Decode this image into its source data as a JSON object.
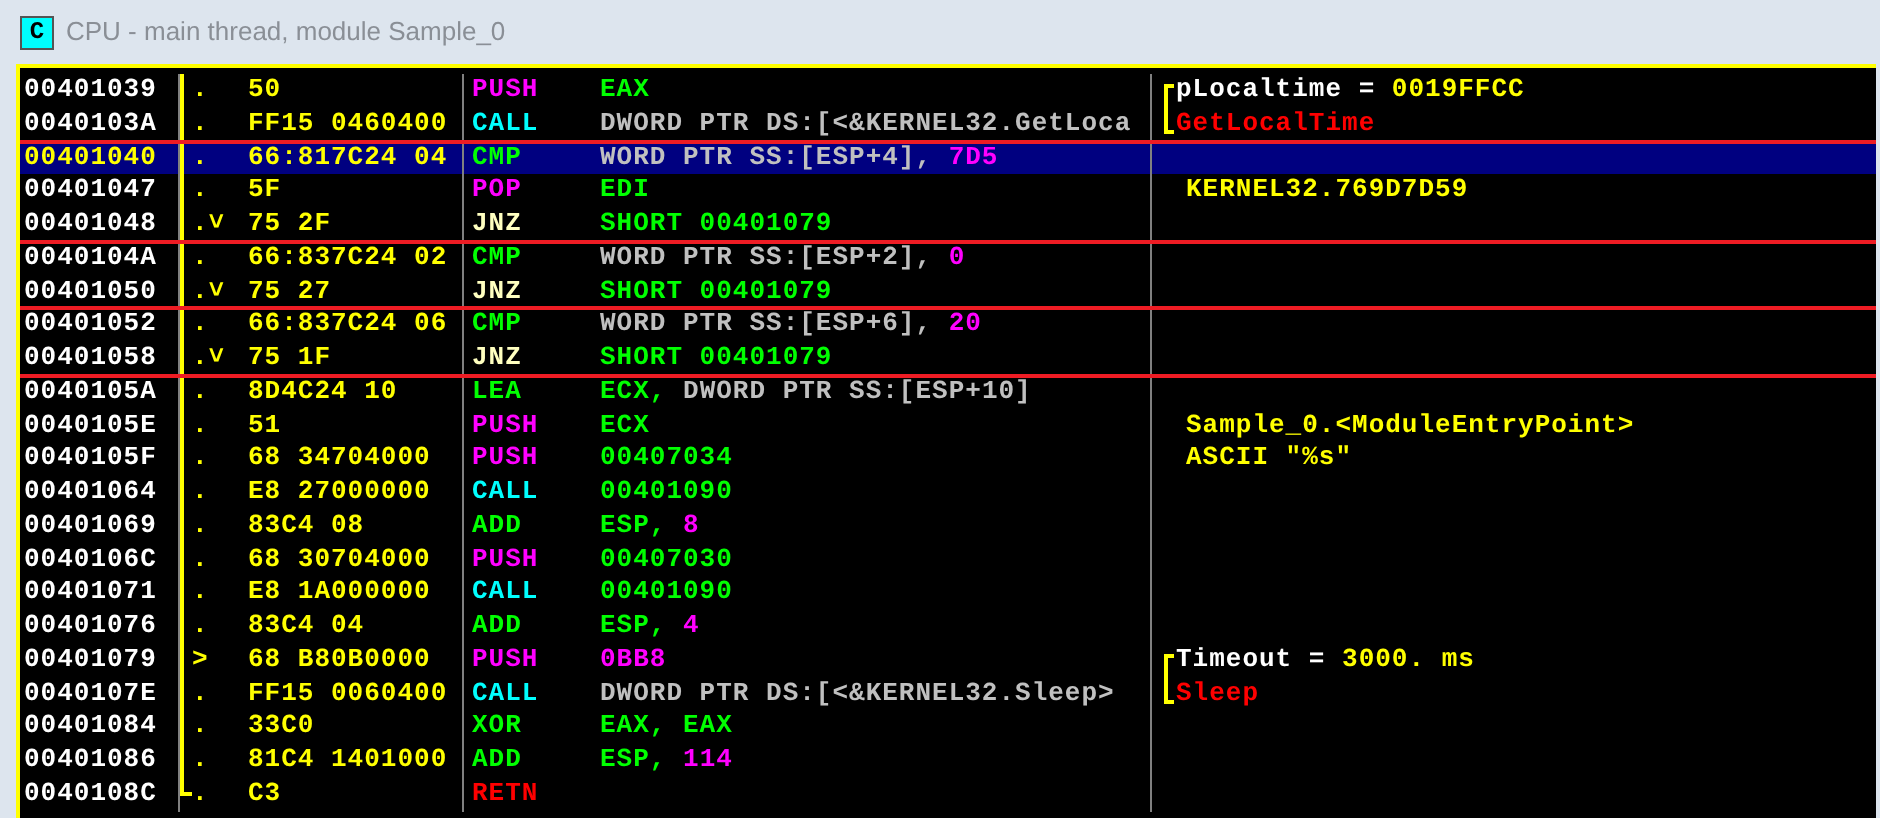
{
  "window": {
    "title": "CPU - main thread, module Sample_0",
    "icon_letter": "C"
  },
  "rows": [
    {
      "address": "00401039",
      "marker": ".",
      "hex": "50",
      "mnemonic": "PUSH",
      "kind": "stack",
      "operands": [
        {
          "text": "EAX",
          "kind": "register"
        }
      ],
      "comment": [
        {
          "text": "pLocaltime = ",
          "kind": "argument"
        },
        {
          "text": "0019FFCC",
          "kind": "value"
        }
      ],
      "bracket_open": true,
      "bracket_close": false,
      "selected": false,
      "red_line_after": false,
      "proc_end": false
    },
    {
      "address": "0040103A",
      "marker": ".",
      "hex": "FF15 0460400",
      "mnemonic": "CALL",
      "kind": "call",
      "operands": [
        {
          "text": "DWORD PTR DS:[<&KERNEL32.GetLoca",
          "kind": "memory"
        }
      ],
      "comment": [
        {
          "text": "GetLocalTime",
          "kind": "function"
        }
      ],
      "bracket_open": false,
      "bracket_close": true,
      "selected": false,
      "red_line_after": true,
      "proc_end": false
    },
    {
      "address": "00401040",
      "marker": ".",
      "hex": "66:817C24 04",
      "mnemonic": "CMP",
      "kind": "plain",
      "operands": [
        {
          "text": "WORD PTR SS:[ESP+4], ",
          "kind": "memory"
        },
        {
          "text": "7D5",
          "kind": "constant"
        }
      ],
      "comment": [],
      "bracket_open": false,
      "bracket_close": false,
      "selected": true,
      "red_line_after": false,
      "proc_end": false
    },
    {
      "address": "00401047",
      "marker": ".",
      "hex": "5F",
      "mnemonic": "POP",
      "kind": "stack",
      "operands": [
        {
          "text": "EDI",
          "kind": "register"
        }
      ],
      "comment": [
        {
          "text": "KERNEL32.769D7D59",
          "kind": "value"
        }
      ],
      "bracket_open": false,
      "bracket_close": false,
      "selected": false,
      "red_line_after": false,
      "proc_end": false
    },
    {
      "address": "00401048",
      "marker": ".˅",
      "hex": "75 2F",
      "mnemonic": "JNZ",
      "kind": "jump",
      "operands": [
        {
          "text": "SHORT 00401079",
          "kind": "register"
        }
      ],
      "comment": [],
      "bracket_open": false,
      "bracket_close": false,
      "selected": false,
      "red_line_after": true,
      "proc_end": false
    },
    {
      "address": "0040104A",
      "marker": ".",
      "hex": "66:837C24 02",
      "mnemonic": "CMP",
      "kind": "plain",
      "operands": [
        {
          "text": "WORD PTR SS:[ESP+2], ",
          "kind": "memory"
        },
        {
          "text": "0",
          "kind": "constant"
        }
      ],
      "comment": [],
      "bracket_open": false,
      "bracket_close": false,
      "selected": false,
      "red_line_after": false,
      "proc_end": false
    },
    {
      "address": "00401050",
      "marker": ".˅",
      "hex": "75 27",
      "mnemonic": "JNZ",
      "kind": "jump",
      "operands": [
        {
          "text": "SHORT 00401079",
          "kind": "register"
        }
      ],
      "comment": [],
      "bracket_open": false,
      "bracket_close": false,
      "selected": false,
      "red_line_after": true,
      "proc_end": false
    },
    {
      "address": "00401052",
      "marker": ".",
      "hex": "66:837C24 06",
      "mnemonic": "CMP",
      "kind": "plain",
      "operands": [
        {
          "text": "WORD PTR SS:[ESP+6], ",
          "kind": "memory"
        },
        {
          "text": "20",
          "kind": "constant"
        }
      ],
      "comment": [],
      "bracket_open": false,
      "bracket_close": false,
      "selected": false,
      "red_line_after": false,
      "proc_end": false
    },
    {
      "address": "00401058",
      "marker": ".˅",
      "hex": "75 1F",
      "mnemonic": "JNZ",
      "kind": "jump",
      "operands": [
        {
          "text": "SHORT 00401079",
          "kind": "register"
        }
      ],
      "comment": [],
      "bracket_open": false,
      "bracket_close": false,
      "selected": false,
      "red_line_after": true,
      "proc_end": false
    },
    {
      "address": "0040105A",
      "marker": ".",
      "hex": "8D4C24 10",
      "mnemonic": "LEA",
      "kind": "plain",
      "operands": [
        {
          "text": "ECX, ",
          "kind": "register"
        },
        {
          "text": "DWORD PTR SS:[ESP+10]",
          "kind": "memory"
        }
      ],
      "comment": [],
      "bracket_open": false,
      "bracket_close": false,
      "selected": false,
      "red_line_after": false,
      "proc_end": false
    },
    {
      "address": "0040105E",
      "marker": ".",
      "hex": "51",
      "mnemonic": "PUSH",
      "kind": "stack",
      "operands": [
        {
          "text": "ECX",
          "kind": "register"
        }
      ],
      "comment": [
        {
          "text": "Sample_0.<ModuleEntryPoint>",
          "kind": "value"
        }
      ],
      "bracket_open": false,
      "bracket_close": false,
      "selected": false,
      "red_line_after": false,
      "proc_end": false
    },
    {
      "address": "0040105F",
      "marker": ".",
      "hex": "68 34704000",
      "mnemonic": "PUSH",
      "kind": "stack",
      "operands": [
        {
          "text": "00407034",
          "kind": "register"
        }
      ],
      "comment": [
        {
          "text": "ASCII \"%s\"",
          "kind": "value"
        }
      ],
      "bracket_open": false,
      "bracket_close": false,
      "selected": false,
      "red_line_after": false,
      "proc_end": false
    },
    {
      "address": "00401064",
      "marker": ".",
      "hex": "E8 27000000",
      "mnemonic": "CALL",
      "kind": "call",
      "operands": [
        {
          "text": "00401090",
          "kind": "register"
        }
      ],
      "comment": [],
      "bracket_open": false,
      "bracket_close": false,
      "selected": false,
      "red_line_after": false,
      "proc_end": false
    },
    {
      "address": "00401069",
      "marker": ".",
      "hex": "83C4 08",
      "mnemonic": "ADD",
      "kind": "plain",
      "operands": [
        {
          "text": "ESP, ",
          "kind": "register"
        },
        {
          "text": "8",
          "kind": "constant"
        }
      ],
      "comment": [],
      "bracket_open": false,
      "bracket_close": false,
      "selected": false,
      "red_line_after": false,
      "proc_end": false
    },
    {
      "address": "0040106C",
      "marker": ".",
      "hex": "68 30704000",
      "mnemonic": "PUSH",
      "kind": "stack",
      "operands": [
        {
          "text": "00407030",
          "kind": "register"
        }
      ],
      "comment": [],
      "bracket_open": false,
      "bracket_close": false,
      "selected": false,
      "red_line_after": false,
      "proc_end": false
    },
    {
      "address": "00401071",
      "marker": ".",
      "hex": "E8 1A000000",
      "mnemonic": "CALL",
      "kind": "call",
      "operands": [
        {
          "text": "00401090",
          "kind": "register"
        }
      ],
      "comment": [],
      "bracket_open": false,
      "bracket_close": false,
      "selected": false,
      "red_line_after": false,
      "proc_end": false
    },
    {
      "address": "00401076",
      "marker": ".",
      "hex": "83C4 04",
      "mnemonic": "ADD",
      "kind": "plain",
      "operands": [
        {
          "text": "ESP, ",
          "kind": "register"
        },
        {
          "text": "4",
          "kind": "constant"
        }
      ],
      "comment": [],
      "bracket_open": false,
      "bracket_close": false,
      "selected": false,
      "red_line_after": false,
      "proc_end": false
    },
    {
      "address": "00401079",
      "marker": ">",
      "hex": "68 B80B0000",
      "mnemonic": "PUSH",
      "kind": "stack",
      "operands": [
        {
          "text": "0BB8",
          "kind": "constant"
        }
      ],
      "comment": [
        {
          "text": "Timeout = ",
          "kind": "argument"
        },
        {
          "text": "3000. ms",
          "kind": "value"
        }
      ],
      "bracket_open": true,
      "bracket_close": false,
      "selected": false,
      "red_line_after": false,
      "proc_end": false
    },
    {
      "address": "0040107E",
      "marker": ".",
      "hex": "FF15 0060400",
      "mnemonic": "CALL",
      "kind": "call",
      "operands": [
        {
          "text": "DWORD PTR DS:[<&KERNEL32.Sleep>",
          "kind": "memory"
        }
      ],
      "comment": [
        {
          "text": "Sleep",
          "kind": "function"
        }
      ],
      "bracket_open": false,
      "bracket_close": true,
      "selected": false,
      "red_line_after": false,
      "proc_end": false
    },
    {
      "address": "00401084",
      "marker": ".",
      "hex": "33C0",
      "mnemonic": "XOR",
      "kind": "plain",
      "operands": [
        {
          "text": "EAX, EAX",
          "kind": "register"
        }
      ],
      "comment": [],
      "bracket_open": false,
      "bracket_close": false,
      "selected": false,
      "red_line_after": false,
      "proc_end": false
    },
    {
      "address": "00401086",
      "marker": ".",
      "hex": "81C4 1401000",
      "mnemonic": "ADD",
      "kind": "plain",
      "operands": [
        {
          "text": "ESP, ",
          "kind": "register"
        },
        {
          "text": "114",
          "kind": "constant"
        }
      ],
      "comment": [],
      "bracket_open": false,
      "bracket_close": false,
      "selected": false,
      "red_line_after": false,
      "proc_end": false
    },
    {
      "address": "0040108C",
      "marker": ".",
      "hex": "C3",
      "mnemonic": "RETN",
      "kind": "return",
      "operands": [],
      "comment": [],
      "bracket_open": false,
      "bracket_close": false,
      "selected": false,
      "red_line_after": false,
      "proc_end": true
    }
  ]
}
